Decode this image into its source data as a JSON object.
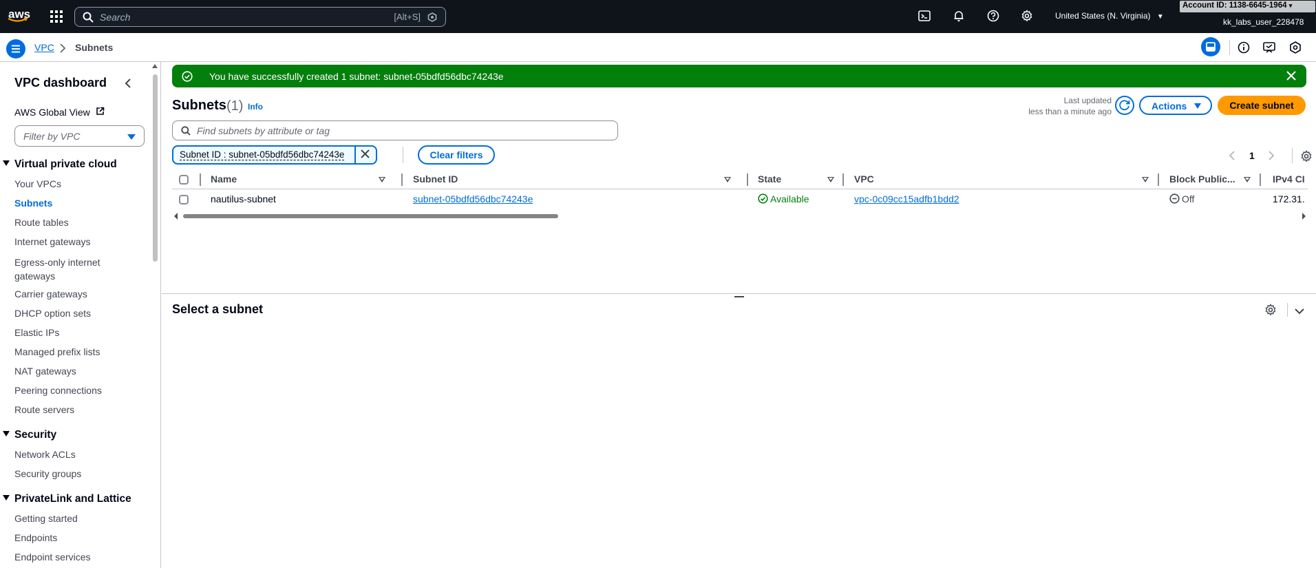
{
  "topbar": {
    "logo_text": "aws",
    "search_placeholder": "Search",
    "search_shortcut": "[Alt+S]",
    "region": "United States (N. Virginia)",
    "account_id": "Account ID: 1138-6645-1964",
    "user": "kk_labs_user_228478"
  },
  "breadcrumb": {
    "service": "VPC",
    "current": "Subnets"
  },
  "sidebar": {
    "title": "VPC dashboard",
    "global_view": "AWS Global View",
    "filter_placeholder": "Filter by VPC",
    "sections": [
      {
        "title": "Virtual private cloud",
        "items": [
          "Your VPCs",
          "Subnets",
          "Route tables",
          "Internet gateways",
          "Egress-only internet gateways",
          "Carrier gateways",
          "DHCP option sets",
          "Elastic IPs",
          "Managed prefix lists",
          "NAT gateways",
          "Peering connections",
          "Route servers"
        ]
      },
      {
        "title": "Security",
        "items": [
          "Network ACLs",
          "Security groups"
        ]
      },
      {
        "title": "PrivateLink and Lattice",
        "items": [
          "Getting started",
          "Endpoints",
          "Endpoint services"
        ]
      }
    ],
    "active_item": "Subnets"
  },
  "flash": {
    "message": "You have successfully created 1 subnet: subnet-05bdfd56dbc74243e"
  },
  "header": {
    "title": "Subnets",
    "count": "(1)",
    "info": "Info",
    "last_updated_label": "Last updated",
    "last_updated_value": "less than a minute ago",
    "actions_label": "Actions",
    "create_label": "Create subnet"
  },
  "filter": {
    "placeholder": "Find subnets by attribute or tag",
    "token": "Subnet ID : subnet-05bdfd56dbc74243e",
    "clear_label": "Clear filters"
  },
  "pagination": {
    "page": "1"
  },
  "table": {
    "columns": [
      "Name",
      "Subnet ID",
      "State",
      "VPC",
      "Block Public...",
      "IPv4 CI"
    ],
    "rows": [
      {
        "name": "nautilus-subnet",
        "subnet_id": "subnet-05bdfd56dbc74243e",
        "state": "Available",
        "vpc": "vpc-0c09cc15adfb1bdd2",
        "block_public": "Off",
        "ipv4": "172.31."
      }
    ]
  },
  "split_panel": {
    "title": "Select a subnet"
  },
  "colors": {
    "primary": "#006ce0",
    "success": "#037f0c",
    "cta": "#ff9900",
    "topbar": "#0f141a"
  }
}
